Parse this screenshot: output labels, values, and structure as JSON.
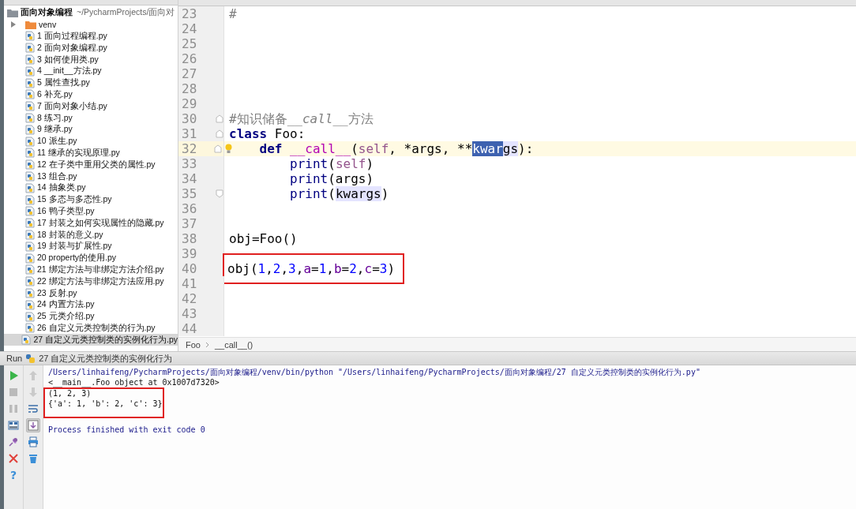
{
  "project": {
    "root": {
      "name": "面向对象编程",
      "path": "~/PycharmProjects/面向对",
      "children": [
        {
          "name": "venv",
          "kind": "folder",
          "expanded": false,
          "selected": false
        },
        {
          "name": "1 面向过程编程.py",
          "kind": "file",
          "selected": false
        },
        {
          "name": "2 面向对象编程.py",
          "kind": "file",
          "selected": false
        },
        {
          "name": "3 如何使用类.py",
          "kind": "file",
          "selected": false
        },
        {
          "name": "4 __init__方法.py",
          "kind": "file",
          "selected": false
        },
        {
          "name": "5 属性查找.py",
          "kind": "file",
          "selected": false
        },
        {
          "name": "6 补充.py",
          "kind": "file",
          "selected": false
        },
        {
          "name": "7 面向对象小结.py",
          "kind": "file",
          "selected": false
        },
        {
          "name": "8 练习.py",
          "kind": "file",
          "selected": false
        },
        {
          "name": "9 继承.py",
          "kind": "file",
          "selected": false
        },
        {
          "name": "10 派生.py",
          "kind": "file",
          "selected": false
        },
        {
          "name": "11 继承的实现原理.py",
          "kind": "file",
          "selected": false
        },
        {
          "name": "12 在子类中重用父类的属性.py",
          "kind": "file",
          "selected": false
        },
        {
          "name": "13 组合.py",
          "kind": "file",
          "selected": false
        },
        {
          "name": "14 抽象类.py",
          "kind": "file",
          "selected": false
        },
        {
          "name": "15 多态与多态性.py",
          "kind": "file",
          "selected": false
        },
        {
          "name": "16 鸭子类型.py",
          "kind": "file",
          "selected": false
        },
        {
          "name": "17 封装之如何实现属性的隐藏.py",
          "kind": "file",
          "selected": false
        },
        {
          "name": "18 封装的意义.py",
          "kind": "file",
          "selected": false
        },
        {
          "name": "19 封装与扩展性.py",
          "kind": "file",
          "selected": false
        },
        {
          "name": "20 property的使用.py",
          "kind": "file",
          "selected": false
        },
        {
          "name": "21 绑定方法与非绑定方法介绍.py",
          "kind": "file",
          "selected": false
        },
        {
          "name": "22 绑定方法与非绑定方法应用.py",
          "kind": "file",
          "selected": false
        },
        {
          "name": "23 反射.py",
          "kind": "file",
          "selected": false
        },
        {
          "name": "24 内置方法.py",
          "kind": "file",
          "selected": false
        },
        {
          "name": "25 元类介绍.py",
          "kind": "file",
          "selected": false
        },
        {
          "name": "26 自定义元类控制类的行为.py",
          "kind": "file",
          "selected": false
        },
        {
          "name": "27 自定义元类控制类的实例化行为.py",
          "kind": "file",
          "selected": true
        }
      ]
    }
  },
  "editor": {
    "lines": [
      {
        "number": "23",
        "current": false,
        "framed": false,
        "tokens": [
          {
            "text": "#",
            "kind": "comment"
          }
        ]
      },
      {
        "number": "24",
        "current": false,
        "framed": false
      },
      {
        "number": "25",
        "current": false,
        "framed": false
      },
      {
        "number": "26",
        "current": false,
        "framed": false
      },
      {
        "number": "27",
        "current": false,
        "framed": false
      },
      {
        "number": "28",
        "current": false,
        "framed": false
      },
      {
        "number": "29",
        "current": false,
        "framed": false
      },
      {
        "number": "30",
        "current": false,
        "framed": false,
        "fold_start": true,
        "fold_end": false,
        "tokens": [
          {
            "text": "#知识储备__",
            "kind": "comment"
          },
          {
            "text": "call",
            "kind": "comment-italic"
          },
          {
            "text": "__方法",
            "kind": "comment"
          }
        ]
      },
      {
        "number": "31",
        "current": false,
        "framed": false,
        "fold_start": true,
        "fold_end": false,
        "tokens": [
          {
            "text": "class",
            "kind": "keyword"
          },
          {
            "text": " Foo:",
            "kind": "plain"
          }
        ]
      },
      {
        "number": "32",
        "current": true,
        "framed": false,
        "fold_start": true,
        "fold_end": false,
        "bulb": true,
        "tokens": [
          {
            "text": "    def",
            "kind": "keyword"
          },
          {
            "text": " __call__",
            "kind": "magic"
          },
          {
            "text": "(",
            "kind": "plain"
          },
          {
            "text": "self",
            "kind": "self"
          },
          {
            "text": ", *args, **",
            "kind": "plain"
          },
          {
            "text": "kwar",
            "kind": "selection"
          },
          {
            "text": "gs",
            "kind": "usage"
          },
          {
            "text": "):",
            "kind": "plain"
          }
        ]
      },
      {
        "number": "33",
        "current": false,
        "framed": false,
        "tokens": [
          {
            "text": "        print",
            "kind": "builtin"
          },
          {
            "text": "(",
            "kind": "plain"
          },
          {
            "text": "self",
            "kind": "self"
          },
          {
            "text": ")",
            "kind": "plain"
          }
        ]
      },
      {
        "number": "34",
        "current": false,
        "framed": false,
        "tokens": [
          {
            "text": "        print",
            "kind": "builtin"
          },
          {
            "text": "(args)",
            "kind": "plain"
          }
        ]
      },
      {
        "number": "35",
        "current": false,
        "framed": false,
        "fold_start": false,
        "fold_end": true,
        "tokens": [
          {
            "text": "        print",
            "kind": "builtin"
          },
          {
            "text": "(",
            "kind": "plain"
          },
          {
            "text": "kwargs",
            "kind": "usage"
          },
          {
            "text": ")",
            "kind": "plain"
          }
        ]
      },
      {
        "number": "36",
        "current": false,
        "framed": false
      },
      {
        "number": "37",
        "current": false,
        "framed": false
      },
      {
        "number": "38",
        "current": false,
        "framed": false,
        "tokens": [
          {
            "text": "obj=Foo()",
            "kind": "plain"
          }
        ]
      },
      {
        "number": "39",
        "current": false,
        "framed": false
      },
      {
        "number": "40",
        "current": false,
        "framed": true,
        "tokens": [
          {
            "text": "obj(",
            "kind": "plain"
          },
          {
            "text": "1",
            "kind": "number"
          },
          {
            "text": ",",
            "kind": "plain"
          },
          {
            "text": "2",
            "kind": "number"
          },
          {
            "text": ",",
            "kind": "plain"
          },
          {
            "text": "3",
            "kind": "number"
          },
          {
            "text": ",",
            "kind": "plain"
          },
          {
            "text": "a",
            "kind": "param"
          },
          {
            "text": "=",
            "kind": "plain"
          },
          {
            "text": "1",
            "kind": "number"
          },
          {
            "text": ",",
            "kind": "plain"
          },
          {
            "text": "b",
            "kind": "param"
          },
          {
            "text": "=",
            "kind": "plain"
          },
          {
            "text": "2",
            "kind": "number"
          },
          {
            "text": ",",
            "kind": "plain"
          },
          {
            "text": "c",
            "kind": "param"
          },
          {
            "text": "=",
            "kind": "plain"
          },
          {
            "text": "3",
            "kind": "number"
          },
          {
            "text": ")",
            "kind": "plain"
          }
        ]
      },
      {
        "number": "41",
        "current": false,
        "framed": false
      },
      {
        "number": "42",
        "current": false,
        "framed": false
      },
      {
        "number": "43",
        "current": false,
        "framed": false
      },
      {
        "number": "44",
        "current": false,
        "framed": false
      }
    ],
    "breadcrumb": [
      "Foo",
      "__call__()"
    ]
  },
  "run_panel": {
    "title": "Run",
    "config": "27 自定义元类控制类的实例化行为",
    "left_tools": [
      {
        "kind": "run",
        "disabled": false
      },
      {
        "kind": "stop",
        "disabled": true
      },
      {
        "kind": "pause",
        "disabled": true
      },
      {
        "kind": "layout",
        "disabled": false
      },
      {
        "kind": "pin",
        "disabled": false
      },
      {
        "kind": "close",
        "disabled": false
      },
      {
        "kind": "help",
        "disabled": false,
        "glyph": "?"
      }
    ],
    "right_tools": [
      {
        "kind": "up",
        "disabled": true,
        "pressed": false
      },
      {
        "kind": "down",
        "disabled": true,
        "pressed": false
      },
      {
        "kind": "wrap",
        "disabled": false,
        "pressed": false
      },
      {
        "kind": "scroll-end",
        "disabled": false,
        "pressed": true
      },
      {
        "kind": "print",
        "disabled": false,
        "pressed": false
      },
      {
        "kind": "delete",
        "disabled": false,
        "pressed": false
      }
    ],
    "output": [
      {
        "text": "/Users/linhaifeng/PycharmProjects/面向对象编程/venv/bin/python \"/Users/linhaifeng/PycharmProjects/面向对象编程/27 自定义元类控制类的实例化行为.py\"",
        "kind": "command",
        "framed": false
      },
      {
        "text": "<__main__.Foo object at 0x1007d7320>",
        "kind": "output",
        "framed": false
      },
      {
        "text": "(1, 2, 3)",
        "kind": "output",
        "framed": true
      },
      {
        "text": "{'a': 1, 'b': 2, 'c': 3}",
        "kind": "output",
        "framed": true
      },
      {
        "text": "Process finished with exit code 0",
        "kind": "info",
        "framed": false
      }
    ]
  }
}
